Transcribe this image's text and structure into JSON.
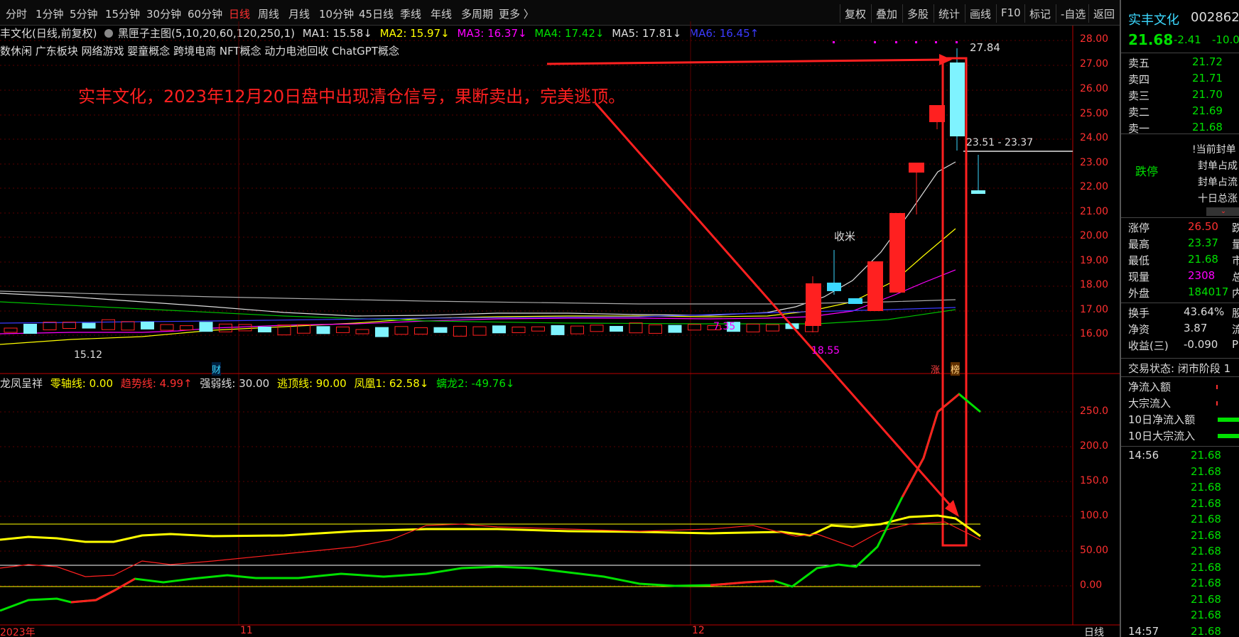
{
  "toolbar": {
    "periods": [
      "分时",
      "1分钟",
      "5分钟",
      "15分钟",
      "30分钟",
      "60分钟",
      "日线",
      "周线",
      "月线",
      "10分钟",
      "45日线",
      "季线",
      "年线",
      "多周期",
      "更多 〉"
    ],
    "active_period": "日线",
    "right_buttons": [
      "复权",
      "叠加",
      "多股",
      "统计",
      "画线",
      "F10",
      "标记",
      "-自选",
      "返回"
    ]
  },
  "info_line": {
    "stock_label": "丰文化(日线,前复权)",
    "indicator": "黑匣子主图(5,10,20,60,120,250,1)",
    "ma1": "MA1: 15.58↓",
    "ma2": "MA2: 15.97↓",
    "ma3": "MA3: 16.37↓",
    "ma4": "MA4: 17.42↓",
    "ma5": "MA5: 17.81↓",
    "ma6": "MA6: 16.45↑"
  },
  "concepts": "数休闲 广东板块 网络游戏 婴童概念 跨境电商 NFT概念 动力电池回收 ChatGPT概念",
  "annotation": "实丰文化，2023年12月20日盘中出现清仓信号，果断卖出，完美逃顶。",
  "chart_labels": {
    "high": "27.84",
    "range": "23.51 - 23.37",
    "shoumi": "收米",
    "low1": "15.12",
    "mark1": "7.35",
    "mark2": "18.55",
    "cai": "财",
    "zhang": "涨",
    "bang": "榜"
  },
  "price_axis": [
    "28.00",
    "27.00",
    "26.00",
    "25.00",
    "24.00",
    "23.00",
    "22.00",
    "21.00",
    "20.00",
    "19.00",
    "18.00",
    "17.00",
    "16.00"
  ],
  "sub_line": {
    "name": "龙凤呈祥",
    "zero": "零轴线: 0.00",
    "trend": "趋势线: 4.99↑",
    "strong": "强弱线: 30.00",
    "escape": "逃顶线: 90.00",
    "phoenix": "凤凰1: 62.58↓",
    "dragon": "螭龙2: -49.76↓"
  },
  "sub_axis": [
    "250.0",
    "200.0",
    "150.0",
    "100.0",
    "50.00",
    "0.00"
  ],
  "date_axis": {
    "d1": "2023年",
    "d2": "11",
    "d3": "12",
    "period": "日线"
  },
  "panel": {
    "name": "实丰文化",
    "code": "002862",
    "price": "21.68",
    "change": "-2.41",
    "pct": "-10.00",
    "asks": [
      {
        "l": "卖五",
        "v": "21.72"
      },
      {
        "l": "卖四",
        "v": "21.71"
      },
      {
        "l": "卖三",
        "v": "21.70"
      },
      {
        "l": "卖二",
        "v": "21.69"
      },
      {
        "l": "卖一",
        "v": "21.68"
      }
    ],
    "limit_status": "跌停",
    "limit_notes": [
      "!当前封单",
      "封单占成",
      "封单占流",
      "十日总涨"
    ],
    "stats": [
      {
        "l": "涨停",
        "v": "26.50",
        "r": "跌"
      },
      {
        "l": "最高",
        "v": "23.37",
        "r": "量"
      },
      {
        "l": "最低",
        "v": "21.68",
        "r": "市"
      },
      {
        "l": "现量",
        "v": "2308",
        "r": "总"
      },
      {
        "l": "外盘",
        "v": "184017",
        "r": "内"
      }
    ],
    "stats2": [
      {
        "l": "换手",
        "v": "43.64%",
        "r": "股"
      },
      {
        "l": "净资",
        "v": "3.87",
        "r": "流"
      },
      {
        "l": "收益(三)",
        "v": "-0.090",
        "r": "P"
      }
    ],
    "trade_status": "交易状态: 闭市阶段 1",
    "flows": [
      "净流入额",
      "大宗流入",
      "10日净流入额",
      "10日大宗流入"
    ],
    "ticks": [
      {
        "t": "14:56",
        "v": "21.68"
      },
      {
        "t": "",
        "v": "21.68"
      },
      {
        "t": "",
        "v": "21.68"
      },
      {
        "t": "",
        "v": "21.68"
      },
      {
        "t": "",
        "v": "21.68"
      },
      {
        "t": "",
        "v": "21.68"
      },
      {
        "t": "",
        "v": "21.68"
      },
      {
        "t": "",
        "v": "21.68"
      },
      {
        "t": "",
        "v": "21.68"
      },
      {
        "t": "",
        "v": "21.68"
      },
      {
        "t": "",
        "v": "21.68"
      },
      {
        "t": "14:57",
        "v": "21.68"
      }
    ]
  }
}
